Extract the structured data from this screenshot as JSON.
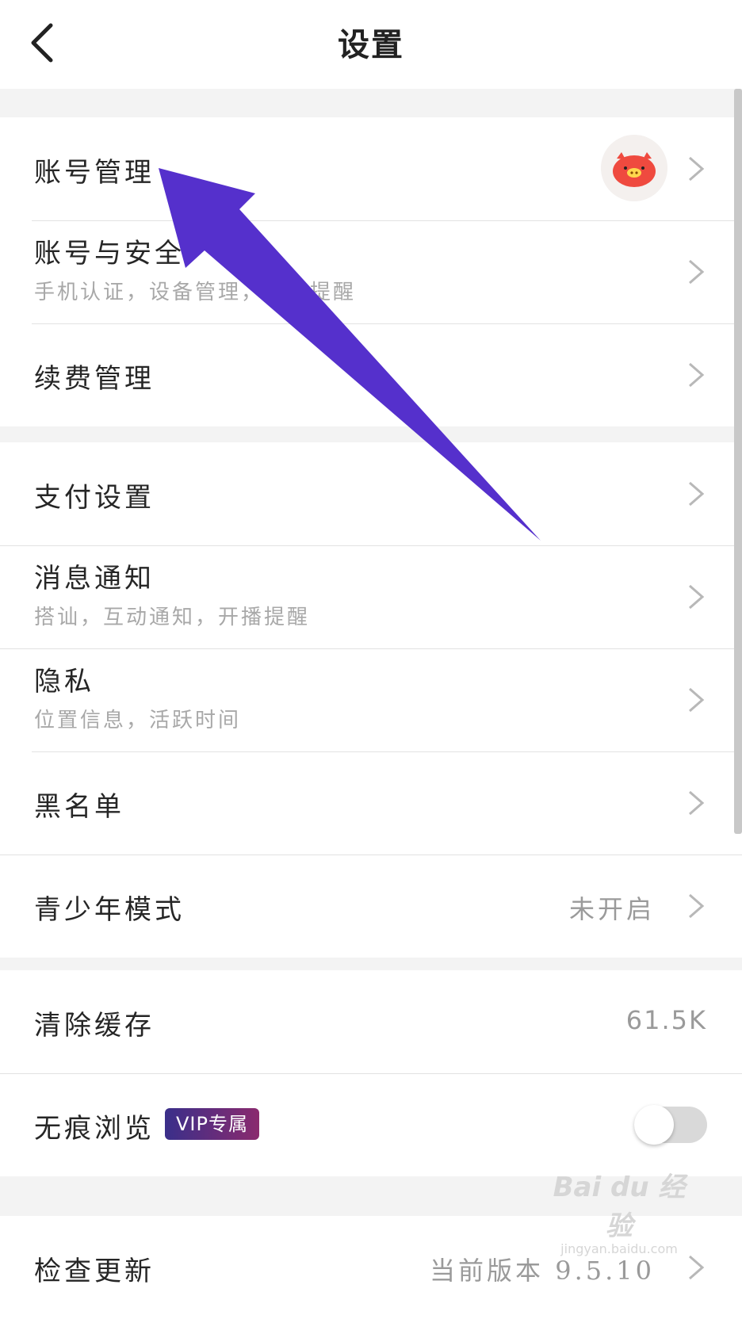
{
  "header": {
    "title": "设置",
    "back_icon": "chevron-left-icon"
  },
  "groups": [
    {
      "rows": [
        {
          "id": "account-management",
          "title": "账号管理",
          "avatar": true
        },
        {
          "id": "account-security",
          "title": "账号与安全",
          "subtitle": "手机认证，设备管理，登录提醒"
        },
        {
          "id": "renewal-management",
          "title": "续费管理"
        }
      ]
    },
    {
      "rows": [
        {
          "id": "payment-settings",
          "title": "支付设置"
        },
        {
          "id": "message-notification",
          "title": "消息通知",
          "subtitle": "搭讪，互动通知，开播提醒"
        },
        {
          "id": "privacy",
          "title": "隐私",
          "subtitle": "位置信息，活跃时间"
        },
        {
          "id": "blacklist",
          "title": "黑名单"
        },
        {
          "id": "youth-mode",
          "title": "青少年模式",
          "value": "未开启"
        }
      ]
    },
    {
      "rows": [
        {
          "id": "clear-cache",
          "title": "清除缓存",
          "value": "61.5K"
        },
        {
          "id": "incognito-browsing",
          "title": "无痕浏览",
          "badge": "VIP专属",
          "toggle": false
        }
      ]
    },
    {
      "rows": [
        {
          "id": "check-update",
          "title": "检查更新",
          "value": "当前版本 9.5.10"
        }
      ]
    }
  ],
  "annotation": {
    "arrow_color": "#5530cc",
    "points_to": "账号管理"
  },
  "watermark": {
    "main": "Bai du 经验",
    "sub": "jingyan.baidu.com"
  }
}
